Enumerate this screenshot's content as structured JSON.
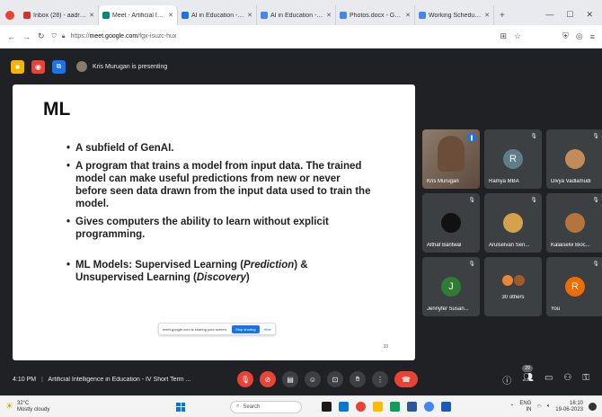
{
  "browser": {
    "tabs": [
      {
        "title": "Inbox (28) - aadr@wlnuty...",
        "color": "#d93025",
        "active": false
      },
      {
        "title": "Meet - Artificial Intelligen...",
        "color": "#00897b",
        "active": true
      },
      {
        "title": "AI in Education - Program...",
        "color": "#1a73e8",
        "active": false
      },
      {
        "title": "AI in Education - Session m...",
        "color": "#4285f4",
        "active": false
      },
      {
        "title": "Photos.docx - Google Docs",
        "color": "#4285f4",
        "active": false
      },
      {
        "title": "Working Schedule.docx - G...",
        "color": "#4285f4",
        "active": false
      }
    ],
    "new_tab": "+",
    "url_prefix": "https://",
    "url_domain": "meet.google.com",
    "url_path": "/fgx-isuzc-hux"
  },
  "meet": {
    "presenting_text": "Kris Murugan is presenting",
    "meeting_time": "4:10 PM",
    "meeting_title": "Artificial Intelligence in Education - IV Short Term ...",
    "participant_count": "29"
  },
  "slide": {
    "title": "ML",
    "bullets": [
      {
        "text": "A subfield of GenAI."
      },
      {
        "text": "A program that trains a model from input data. The trained model can make useful predictions from new or never before seen data drawn from the input data used to train the model."
      },
      {
        "text": "Gives computers the ability to learn without explicit programming."
      }
    ],
    "ml_models": {
      "prefix": "ML Models: Supervised Learning (",
      "em1": "Prediction",
      "mid": ") & Unsupervised Learning (",
      "em2": "Discovery",
      "suffix": ")"
    },
    "share_text": "meet.google.com is sharing your screen.",
    "stop_label": "Stop sharing",
    "hide_label": "Hide",
    "page_number": "33"
  },
  "participants": [
    {
      "name": "Kris Murugan",
      "type": "camera",
      "speaking": true
    },
    {
      "name": "Ramya MBA",
      "type": "letter",
      "letter": "R",
      "color": "#607d8b"
    },
    {
      "name": "Divya Vadlamudi",
      "type": "photo",
      "color": "#c48b5a"
    },
    {
      "name": "Althaf Bantwal",
      "type": "photo",
      "color": "#111111"
    },
    {
      "name": "Arulselvan Sen...",
      "type": "photo",
      "color": "#d4a24c"
    },
    {
      "name": "Kalaiselvi Bioc...",
      "type": "photo",
      "color": "#b5733e"
    },
    {
      "name": "Jennyfer Susan...",
      "type": "letter",
      "letter": "J",
      "color": "#2e7d32"
    },
    {
      "name": "30 others",
      "type": "others",
      "color": "#e8863a"
    },
    {
      "name": "You",
      "type": "letter",
      "letter": "R",
      "color": "#ef6c00"
    }
  ],
  "taskbar": {
    "temperature": "32°C",
    "weather": "Mostly cloudy",
    "search_placeholder": "Search",
    "lang": "ENG",
    "region": "IN",
    "time": "16:10",
    "date": "19-06-2023"
  }
}
